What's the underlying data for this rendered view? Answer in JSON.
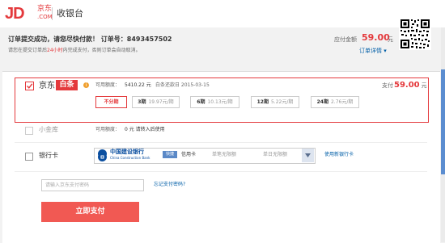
{
  "header": {
    "logo_main": "JD",
    "logo_cn": "京东",
    "logo_com": ".COM",
    "cashier_title": "收银台"
  },
  "order": {
    "message": "订单提交成功，请您尽快付款！",
    "order_no_label": "订单号：",
    "order_no": "8493457502",
    "tip_prefix": "请您在提交订单后",
    "tip_time": "24小时",
    "tip_suffix": "内完成支付，否则订单会自动取消。",
    "due_label": "应付金额",
    "due_amount": "59.00",
    "due_unit": "元",
    "detail_link": "订单详情 ▾"
  },
  "baitiao": {
    "brand": "京东",
    "tag": "白条",
    "available_label": "可用额度：",
    "available_value": "5410.22 元",
    "repay_label": "白条还款日 2015-03-15",
    "pay_label": "支付",
    "pay_amount": "59.00",
    "pay_unit": "元",
    "installments": [
      {
        "term": "不分期",
        "fee": "",
        "selected": true
      },
      {
        "term": "3期",
        "fee": "19.97元/期",
        "selected": false
      },
      {
        "term": "6期",
        "fee": "10.13元/期",
        "selected": false
      },
      {
        "term": "12期",
        "fee": "5.22元/期",
        "selected": false
      },
      {
        "term": "24期",
        "fee": "2.76元/期",
        "selected": false
      }
    ]
  },
  "xiaojinku": {
    "label": "小金库",
    "available_label": "可用额度：",
    "available_value": "0 元  请转入后使用"
  },
  "bank": {
    "label": "银行卡",
    "bank_name": "中国建设银行",
    "bank_en": "China Construction Bank",
    "quick_tag": "快捷",
    "card_type": "信用卡",
    "limit_single": "单笔无限额",
    "limit_daily": "单日无限额",
    "use_new": "使用新银行卡"
  },
  "password": {
    "placeholder": "请输入京东支付密码",
    "forgot": "忘记支付密码?"
  },
  "actions": {
    "pay_button": "立即支付"
  },
  "colors": {
    "brand_red": "#e4393c",
    "link_blue": "#005ea7",
    "button_red": "#f15953"
  }
}
